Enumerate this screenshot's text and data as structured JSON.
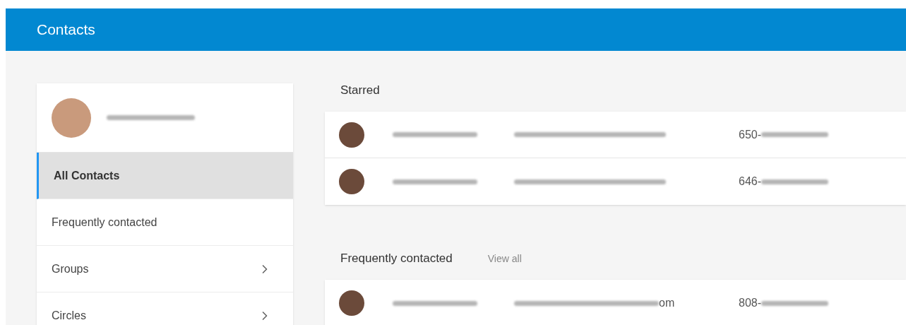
{
  "app_bar": {
    "title": "Contacts"
  },
  "sidebar": {
    "items": [
      {
        "label": "All Contacts",
        "selected": true,
        "has_submenu": false
      },
      {
        "label": "Frequently contacted",
        "selected": false,
        "has_submenu": false
      },
      {
        "label": "Groups",
        "selected": false,
        "has_submenu": true
      },
      {
        "label": "Circles",
        "selected": false,
        "has_submenu": true
      }
    ]
  },
  "sections": [
    {
      "title": "Starred",
      "rows": [
        {
          "phone": "650-"
        },
        {
          "phone": "646-"
        }
      ]
    },
    {
      "title": "Frequently contacted",
      "link": "View all",
      "rows": [
        {
          "email_tail": "om",
          "phone": "808-"
        }
      ]
    }
  ]
}
